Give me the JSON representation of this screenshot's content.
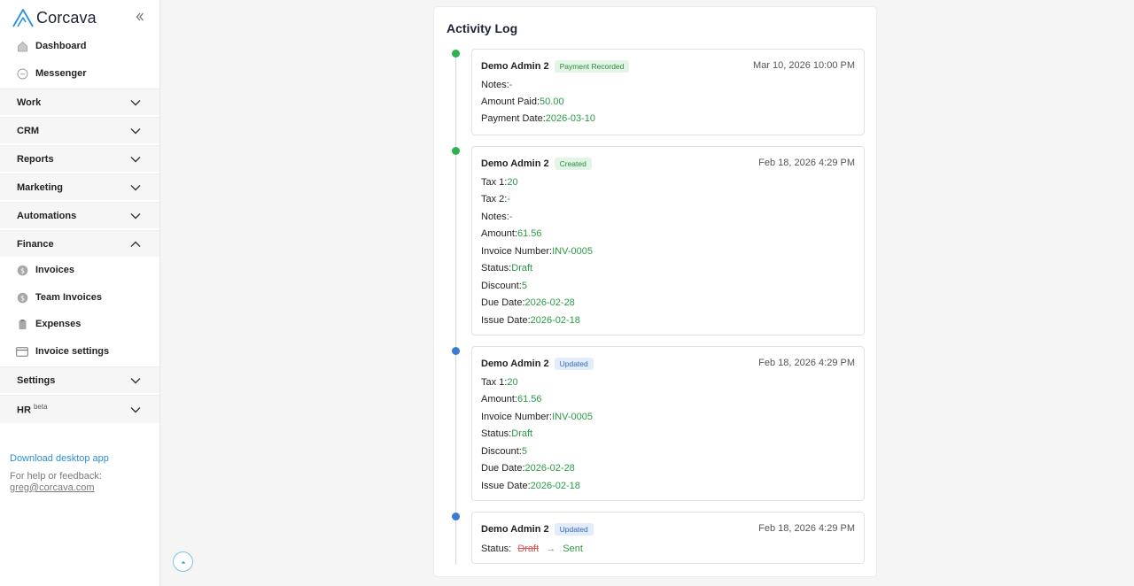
{
  "brand": {
    "name": "Corcava",
    "accent": "#2b8fd6"
  },
  "nav": {
    "items": [
      {
        "label": "Dashboard",
        "icon": "dashboard-icon"
      },
      {
        "label": "Messenger",
        "icon": "messenger-icon"
      }
    ],
    "sections": [
      {
        "label": "Work",
        "expanded": false
      },
      {
        "label": "CRM",
        "expanded": false
      },
      {
        "label": "Reports",
        "expanded": false
      },
      {
        "label": "Marketing",
        "expanded": false
      },
      {
        "label": "Automations",
        "expanded": false
      },
      {
        "label": "Finance",
        "expanded": true
      },
      {
        "label": "Settings",
        "expanded": false
      },
      {
        "label": "HR",
        "sup": "beta",
        "expanded": false
      }
    ],
    "finance_items": [
      {
        "label": "Invoices",
        "icon": "dollar-icon"
      },
      {
        "label": "Team Invoices",
        "icon": "dollar-icon"
      },
      {
        "label": "Expenses",
        "icon": "clipboard-icon"
      },
      {
        "label": "Invoice settings",
        "icon": "card-icon"
      }
    ]
  },
  "footer": {
    "download": "Download desktop app",
    "help": "For help or feedback:",
    "email": "greg@corcava.com"
  },
  "activity": {
    "title": "Activity Log",
    "entries": [
      {
        "author": "Demo Admin 2",
        "badge": "Payment Recorded",
        "badge_color": "green",
        "time": "Mar 10, 2026 10:00 PM",
        "fields": [
          {
            "label": "Notes:",
            "value": "-"
          },
          {
            "label": "Amount Paid:",
            "value": "50.00"
          },
          {
            "label": "Payment Date:",
            "value": "2026-03-10"
          }
        ]
      },
      {
        "author": "Demo Admin 2",
        "badge": "Created",
        "badge_color": "green",
        "time": "Feb 18, 2026 4:29 PM",
        "fields": [
          {
            "label": "Tax 1:",
            "value": "20"
          },
          {
            "label": "Tax 2:",
            "value": "-"
          },
          {
            "label": "Notes:",
            "value": "-"
          },
          {
            "label": "Amount:",
            "value": "61.56"
          },
          {
            "label": "Invoice Number:",
            "value": "INV-0005"
          },
          {
            "label": "Status:",
            "value": "Draft"
          },
          {
            "label": "Discount:",
            "value": "5"
          },
          {
            "label": "Due Date:",
            "value": "2026-02-28"
          },
          {
            "label": "Issue Date:",
            "value": "2026-02-18"
          }
        ]
      },
      {
        "author": "Demo Admin 2",
        "badge": "Updated",
        "badge_color": "blue",
        "time": "Feb 18, 2026 4:29 PM",
        "fields": [
          {
            "label": "Tax 1:",
            "value": "20"
          },
          {
            "label": "Amount:",
            "value": "61.56"
          },
          {
            "label": "Invoice Number:",
            "value": "INV-0005"
          },
          {
            "label": "Status:",
            "value": "Draft"
          },
          {
            "label": "Discount:",
            "value": "5"
          },
          {
            "label": "Due Date:",
            "value": "2026-02-28"
          },
          {
            "label": "Issue Date:",
            "value": "2026-02-18"
          }
        ]
      },
      {
        "author": "Demo Admin 2",
        "badge": "Updated",
        "badge_color": "blue",
        "time": "Feb 18, 2026 4:29 PM",
        "change": {
          "label": "Status:",
          "from": "Draft",
          "to": "Sent"
        }
      }
    ]
  }
}
